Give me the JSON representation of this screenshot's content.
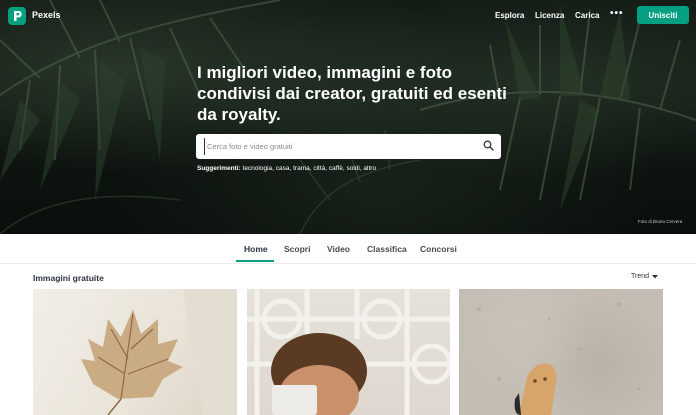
{
  "nav": {
    "brand": "Pexels",
    "links": [
      "Esplora",
      "Licenza",
      "Carica"
    ],
    "more": "•••",
    "join_label": "Unisciti"
  },
  "hero": {
    "headline": "I migliori video, immagini e foto condivisi dai creator, gratuiti ed esenti da royalty.",
    "search_placeholder": "Cerca foto e video gratuiti",
    "suggestions_label": "Suggerimenti:",
    "suggestions": "tecnologia, casa, trama, città, caffè, soldi, altro",
    "photo_credit": "Foto di Bruno Cervera"
  },
  "tabs": {
    "items": [
      "Home",
      "Scopri",
      "Video",
      "Classifica",
      "Concorsi"
    ],
    "active": "Home"
  },
  "section": {
    "title": "Immagini gratuite",
    "sort_label": "Trend"
  },
  "colors": {
    "accent": "#05a081",
    "text": "#2c343e"
  }
}
